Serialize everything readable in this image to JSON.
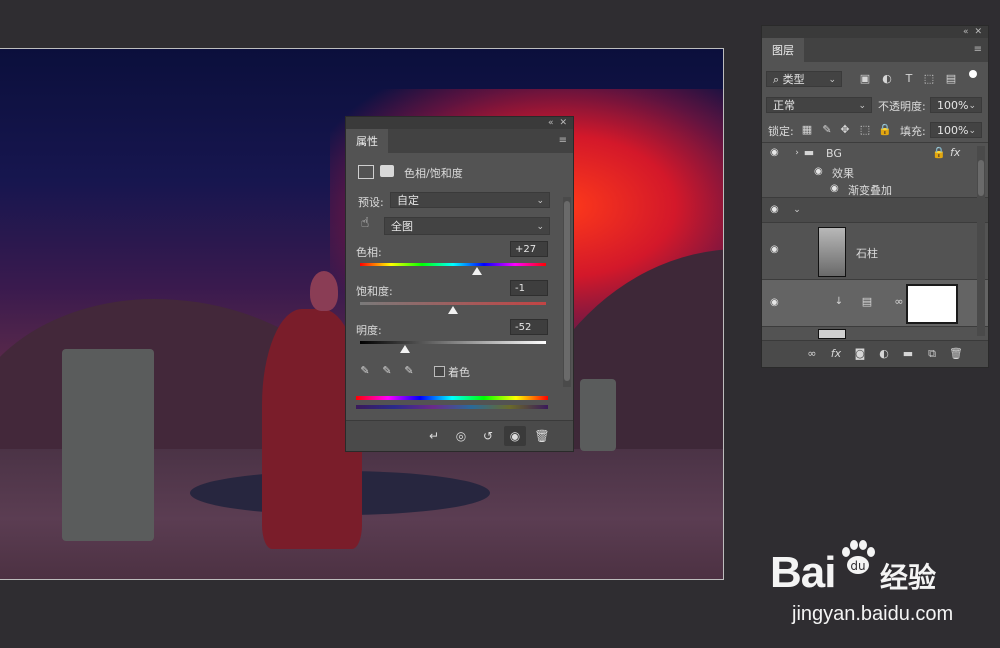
{
  "properties_panel": {
    "tab": "属性",
    "adjustment_title": "色相/饱和度",
    "preset_label": "预设:",
    "preset_value": "自定",
    "channel_value": "全图",
    "hue_label": "色相:",
    "hue_value": "+27",
    "hue_position": 0.63,
    "saturation_label": "饱和度:",
    "saturation_value": "-1",
    "saturation_position": 0.5,
    "lightness_label": "明度:",
    "lightness_value": "-52",
    "lightness_position": 0.24,
    "colorize_label": "着色"
  },
  "layers_panel": {
    "tab": "图层",
    "filter_value": "类型",
    "blend_mode": "正常",
    "opacity_label": "不透明度:",
    "opacity_value": "100%",
    "lock_label": "锁定:",
    "fill_label": "填充:",
    "fill_value": "100%",
    "layers": [
      {
        "name": "BG",
        "type": "group"
      },
      {
        "name": "效果",
        "type": "effects"
      },
      {
        "name": "渐变叠加",
        "type": "effect"
      },
      {
        "name": "",
        "type": "group-expanded"
      },
      {
        "name": "石柱",
        "type": "image"
      },
      {
        "name": "",
        "type": "adjustment"
      }
    ]
  },
  "watermark": {
    "logo": "Bai",
    "logo_tail": "经验",
    "url": "jingyan.baidu.com"
  },
  "colors": {
    "panel_bg": "#535353",
    "panel_header": "#424242",
    "workspace_bg": "#2f2d31"
  },
  "icons": {
    "panel_menu": "hamburger-icon",
    "eye": "eye-icon",
    "folder": "folder-icon"
  }
}
